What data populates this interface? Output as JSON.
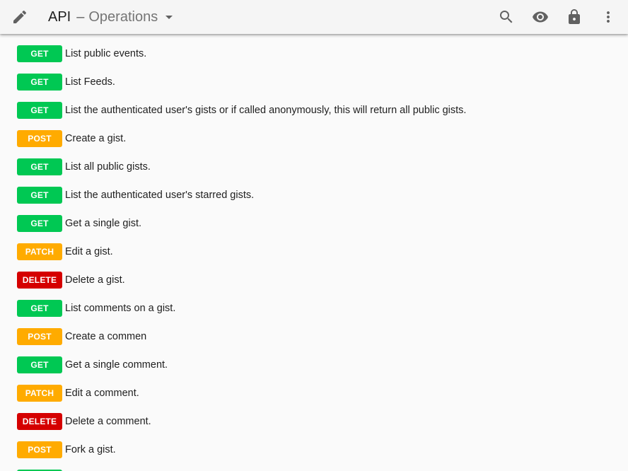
{
  "toolbar": {
    "edit_icon": "pencil-icon",
    "title_app": "API",
    "title_separator": "–",
    "title_section": "Operations",
    "caret_icon": "caret-down-icon",
    "actions": [
      {
        "name": "search-button",
        "icon": "search-icon"
      },
      {
        "name": "view-button",
        "icon": "eye-icon"
      },
      {
        "name": "lock-button",
        "icon": "lock-icon"
      },
      {
        "name": "more-button",
        "icon": "more-vert-icon"
      }
    ]
  },
  "method_colors": {
    "GET": "#00c853",
    "POST": "#ffab00",
    "PATCH": "#ffab00",
    "DELETE": "#d50000"
  },
  "operations": [
    {
      "method": "GET",
      "summary": "List public events."
    },
    {
      "method": "GET",
      "summary": "List Feeds."
    },
    {
      "method": "GET",
      "summary": "List the authenticated user's gists or if called anonymously, this will return all public gists."
    },
    {
      "method": "POST",
      "summary": "Create a gist."
    },
    {
      "method": "GET",
      "summary": "List all public gists."
    },
    {
      "method": "GET",
      "summary": "List the authenticated user's starred gists."
    },
    {
      "method": "GET",
      "summary": "Get a single gist."
    },
    {
      "method": "PATCH",
      "summary": "Edit a gist."
    },
    {
      "method": "DELETE",
      "summary": "Delete a gist."
    },
    {
      "method": "GET",
      "summary": "List comments on a gist."
    },
    {
      "method": "POST",
      "summary": "Create a commen"
    },
    {
      "method": "GET",
      "summary": "Get a single comment."
    },
    {
      "method": "PATCH",
      "summary": "Edit a comment."
    },
    {
      "method": "DELETE",
      "summary": "Delete a comment."
    },
    {
      "method": "POST",
      "summary": "Fork a gist."
    }
  ]
}
